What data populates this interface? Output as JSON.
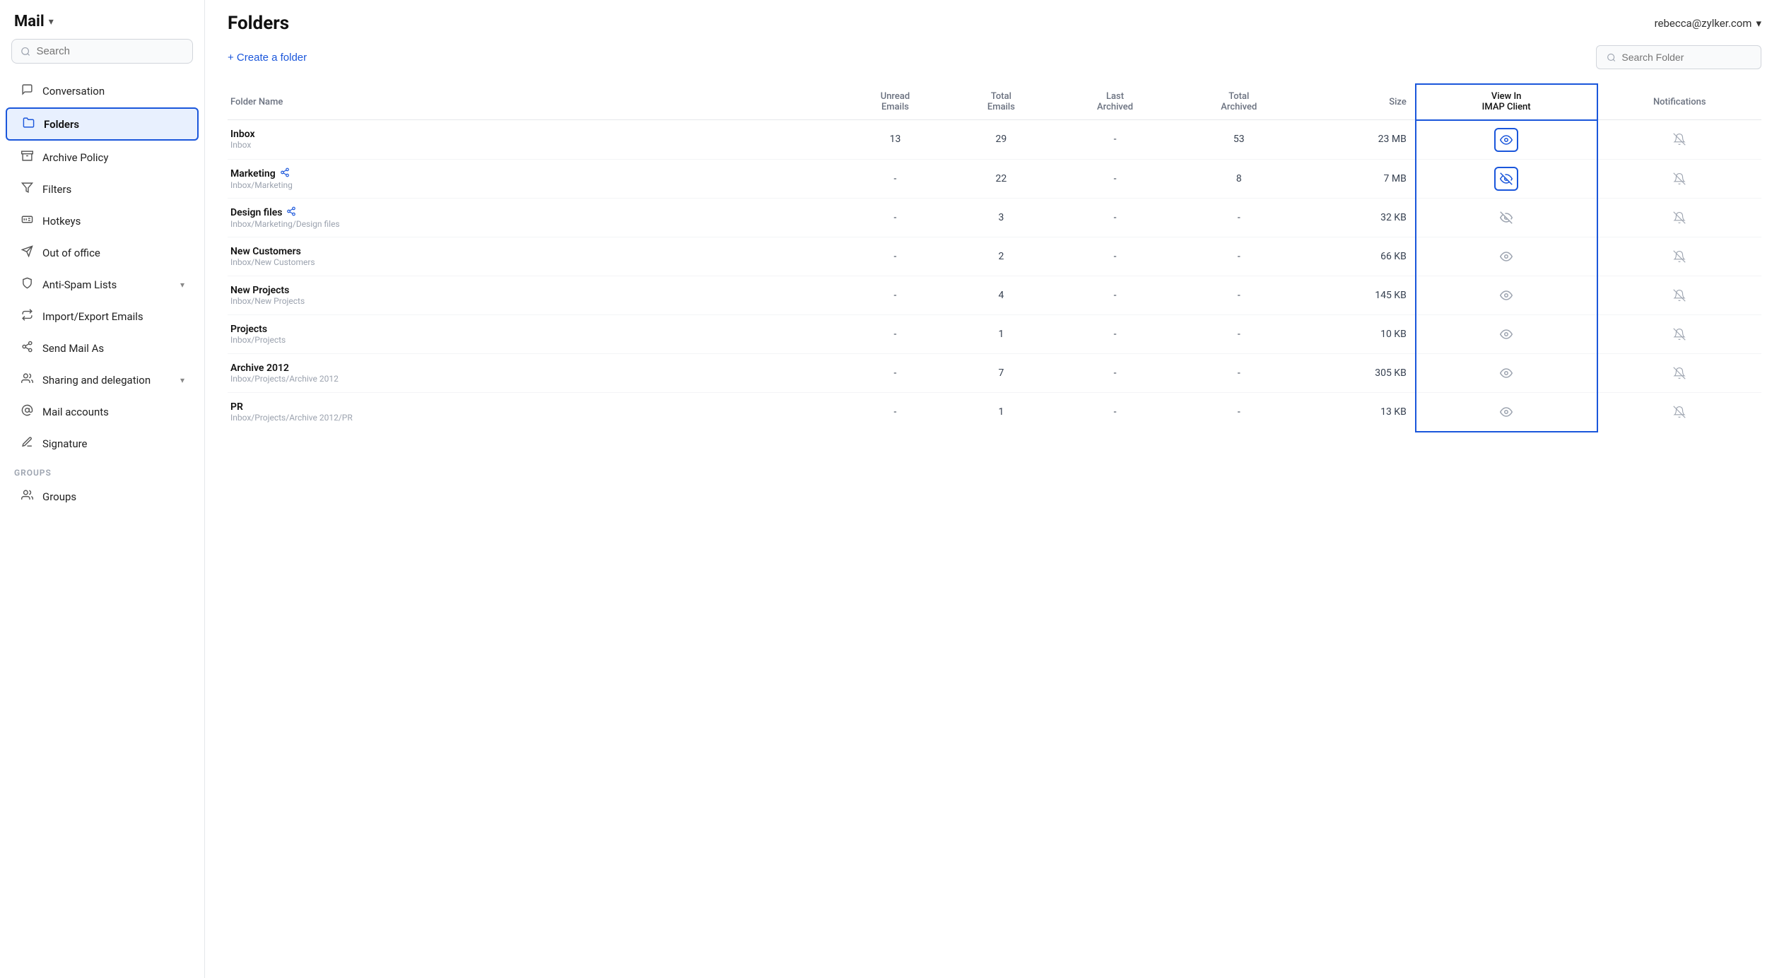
{
  "app": {
    "title": "Mail",
    "user_email": "rebecca@zylker.com"
  },
  "sidebar": {
    "search_placeholder": "Search",
    "nav_items": [
      {
        "id": "conversation",
        "label": "Conversation",
        "icon": "speech-bubble"
      },
      {
        "id": "folders",
        "label": "Folders",
        "icon": "folder",
        "active": true
      },
      {
        "id": "archive-policy",
        "label": "Archive Policy",
        "icon": "archive"
      },
      {
        "id": "filters",
        "label": "Filters",
        "icon": "filter"
      },
      {
        "id": "hotkeys",
        "label": "Hotkeys",
        "icon": "hashtag"
      },
      {
        "id": "out-of-office",
        "label": "Out of office",
        "icon": "plane"
      },
      {
        "id": "anti-spam",
        "label": "Anti-Spam Lists",
        "icon": "shield",
        "has_arrow": true
      },
      {
        "id": "import-export",
        "label": "Import/Export Emails",
        "icon": "arrows"
      },
      {
        "id": "send-mail-as",
        "label": "Send Mail As",
        "icon": "share"
      },
      {
        "id": "sharing-delegation",
        "label": "Sharing and delegation",
        "icon": "person-share",
        "has_arrow": true
      },
      {
        "id": "mail-accounts",
        "label": "Mail accounts",
        "icon": "at"
      },
      {
        "id": "signature",
        "label": "Signature",
        "icon": "pen"
      }
    ],
    "groups_label": "GROUPS",
    "groups_items": [
      {
        "id": "groups",
        "label": "Groups",
        "icon": "person-group"
      }
    ]
  },
  "page": {
    "title": "Folders"
  },
  "toolbar": {
    "create_folder_label": "+ Create a folder",
    "search_folder_placeholder": "Search Folder"
  },
  "table": {
    "columns": [
      {
        "id": "folder-name",
        "label": "Folder Name"
      },
      {
        "id": "unread-emails",
        "label": "Unread\nEmails"
      },
      {
        "id": "total-emails",
        "label": "Total\nEmails"
      },
      {
        "id": "last-archived",
        "label": "Last\nArchived"
      },
      {
        "id": "total-archived",
        "label": "Total\nArchived"
      },
      {
        "id": "size",
        "label": "Size"
      },
      {
        "id": "view-imap",
        "label": "View In\nIMAP Client"
      },
      {
        "id": "notifications",
        "label": "Notifications"
      }
    ],
    "rows": [
      {
        "name": "Inbox",
        "path": "Inbox",
        "shared": false,
        "unread": "13",
        "total": "29",
        "last_archived": "-",
        "total_archived": "53",
        "size": "23 MB",
        "imap_visible": true,
        "imap_bordered": true,
        "imap_hidden": false,
        "notifications": true
      },
      {
        "name": "Marketing",
        "path": "Inbox/Marketing",
        "shared": true,
        "unread": "-",
        "total": "22",
        "last_archived": "-",
        "total_archived": "8",
        "size": "7 MB",
        "imap_visible": true,
        "imap_bordered": true,
        "imap_hidden": true,
        "notifications": true
      },
      {
        "name": "Design files",
        "path": "Inbox/Marketing/Design files",
        "shared": true,
        "unread": "-",
        "total": "3",
        "last_archived": "-",
        "total_archived": "-",
        "size": "32 KB",
        "imap_visible": true,
        "imap_bordered": false,
        "imap_hidden": true,
        "notifications": true
      },
      {
        "name": "New Customers",
        "path": "Inbox/New Customers",
        "shared": false,
        "unread": "-",
        "total": "2",
        "last_archived": "-",
        "total_archived": "-",
        "size": "66 KB",
        "imap_visible": true,
        "imap_bordered": false,
        "imap_hidden": false,
        "notifications": true
      },
      {
        "name": "New Projects",
        "path": "Inbox/New Projects",
        "shared": false,
        "unread": "-",
        "total": "4",
        "last_archived": "-",
        "total_archived": "-",
        "size": "145 KB",
        "imap_visible": true,
        "imap_bordered": false,
        "imap_hidden": false,
        "notifications": true
      },
      {
        "name": "Projects",
        "path": "Inbox/Projects",
        "shared": false,
        "unread": "-",
        "total": "1",
        "last_archived": "-",
        "total_archived": "-",
        "size": "10 KB",
        "imap_visible": true,
        "imap_bordered": false,
        "imap_hidden": false,
        "notifications": true
      },
      {
        "name": "Archive 2012",
        "path": "Inbox/Projects/Archive 2012",
        "shared": false,
        "unread": "-",
        "total": "7",
        "last_archived": "-",
        "total_archived": "-",
        "size": "305 KB",
        "imap_visible": true,
        "imap_bordered": false,
        "imap_hidden": false,
        "notifications": true
      },
      {
        "name": "PR",
        "path": "Inbox/Projects/Archive 2012/PR",
        "shared": false,
        "unread": "-",
        "total": "1",
        "last_archived": "-",
        "total_archived": "-",
        "size": "13 KB",
        "imap_visible": true,
        "imap_bordered": false,
        "imap_hidden": false,
        "notifications": true
      }
    ]
  },
  "colors": {
    "accent": "#1a56db",
    "border": "#e5e7eb",
    "text_muted": "#9ca3af"
  }
}
